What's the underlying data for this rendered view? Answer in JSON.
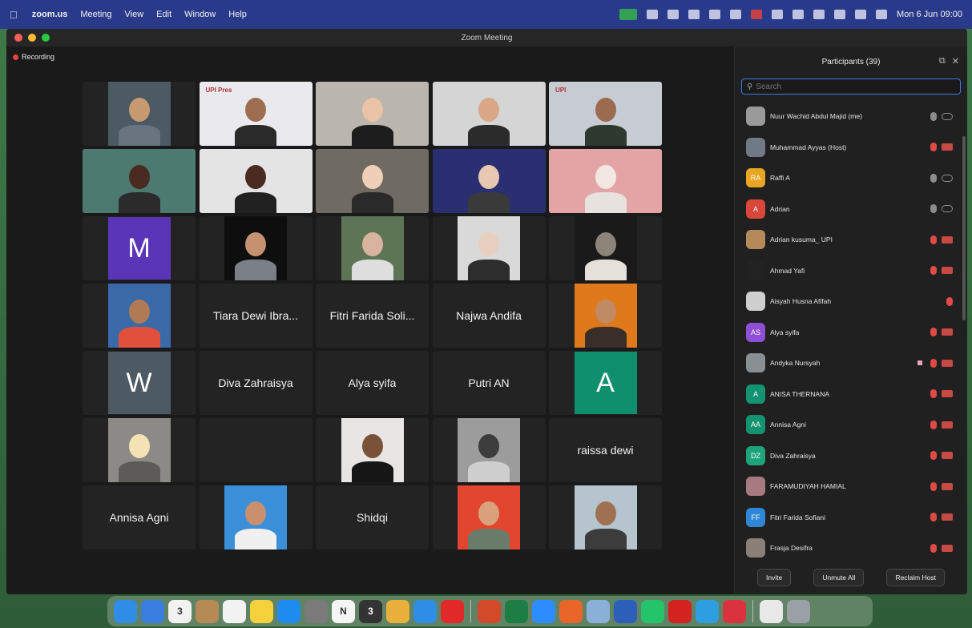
{
  "menubar": {
    "app_name": "zoom.us",
    "menus": [
      "Meeting",
      "View",
      "Edit",
      "Window",
      "Help"
    ],
    "clock": "Mon 6 Jun 09:00"
  },
  "window": {
    "title": "Zoom Meeting"
  },
  "recording": {
    "label": "Recording"
  },
  "gallery": {
    "tiles": [
      {
        "type": "video",
        "bg": "#4b5a63",
        "skin": "#c89a72",
        "shirt": "#6a7380"
      },
      {
        "type": "video",
        "bg": "#e9e9ee",
        "skin": "#9d6e50",
        "shirt": "#2a2a2a",
        "banner": "UPI Pres"
      },
      {
        "type": "video",
        "bg": "#bab6ad",
        "skin": "#e9c3a6",
        "shirt": "#1d1d1d"
      },
      {
        "type": "video",
        "bg": "#d5d5d5",
        "skin": "#d9a788",
        "shirt": "#2b2b2b"
      },
      {
        "type": "video",
        "bg": "#c7ccd3",
        "skin": "#9b6b4f",
        "shirt": "#2e3930",
        "banner": "UPI"
      },
      {
        "type": "video",
        "bg": "#4d7a70",
        "skin": "#4a2b1f",
        "shirt": "#2b2b2b",
        "speaking": true
      },
      {
        "type": "video",
        "bg": "#e4e4e4",
        "skin": "#4a2b20",
        "shirt": "#212121"
      },
      {
        "type": "video",
        "bg": "#6f6a62",
        "skin": "#f0cfb8",
        "shirt": "#2a2a2a"
      },
      {
        "type": "video",
        "bg": "#2a2f72",
        "skin": "#e8c8b0",
        "shirt": "#3a3a3a"
      },
      {
        "type": "video",
        "bg": "#e3a4a6",
        "skin": "#f2e8e1",
        "shirt": "#e8e2de"
      },
      {
        "type": "letter",
        "letter": "M",
        "color": "#5b35b8"
      },
      {
        "type": "video",
        "bg": "#0e0e0e",
        "skin": "#c49270",
        "shirt": "#7a7f88"
      },
      {
        "type": "video",
        "bg": "#5d7554",
        "skin": "#d8b4a0",
        "shirt": "#dedede"
      },
      {
        "type": "video",
        "bg": "#d9d9d9",
        "skin": "#e8d0c0",
        "shirt": "#2d2d2d"
      },
      {
        "type": "video",
        "bg": "#1a1a1a",
        "skin": "#8c8478",
        "shirt": "#e6e1da"
      },
      {
        "type": "video",
        "bg": "#3a6ba8",
        "skin": "#b07a55",
        "shirt": "#e0503a"
      },
      {
        "type": "name",
        "name": "Tiara Dewi Ibra..."
      },
      {
        "type": "name",
        "name": "Fitri Farida Soli..."
      },
      {
        "type": "name",
        "name": "Najwa Andifa"
      },
      {
        "type": "video",
        "bg": "#e0781c",
        "skin": "#c08a64",
        "shirt": "#3a2e28"
      },
      {
        "type": "letter",
        "letter": "W",
        "color": "#4e5a63"
      },
      {
        "type": "name",
        "name": "Diva Zahraisya"
      },
      {
        "type": "name",
        "name": "Alya syifa"
      },
      {
        "type": "name",
        "name": "Putri AN"
      },
      {
        "type": "letter",
        "letter": "A",
        "color": "#0f8f6e"
      },
      {
        "type": "video",
        "bg": "#8c8a86",
        "skin": "#f3e2b4",
        "shirt": "#5c5b58"
      },
      {
        "type": "empty"
      },
      {
        "type": "video",
        "bg": "#e8e6e4",
        "skin": "#7a5238",
        "shirt": "#161616"
      },
      {
        "type": "video",
        "bg": "#9c9c9c",
        "skin": "#3c3c3c",
        "shirt": "#cfcfcf"
      },
      {
        "type": "name",
        "name": "raissa dewi"
      },
      {
        "type": "name",
        "name": "Annisa Agni"
      },
      {
        "type": "video",
        "bg": "#3a8fd8",
        "skin": "#c8906c",
        "shirt": "#f0f0f0"
      },
      {
        "type": "name",
        "name": "Shidqi"
      },
      {
        "type": "video",
        "bg": "#e2462f",
        "skin": "#d9a27c",
        "shirt": "#6a7b6a"
      },
      {
        "type": "video",
        "bg": "#b6c4ce",
        "skin": "#a07052",
        "shirt": "#3c3c3c"
      }
    ]
  },
  "panel": {
    "title": "Participants (39)",
    "search_placeholder": "Search",
    "participants": [
      {
        "name": "Nuur Wachid Abdul Majid (me)",
        "initials": "",
        "color": "#9a9a9a",
        "mic": "on",
        "video": "on"
      },
      {
        "name": "Muhammad Ayyas (Host)",
        "initials": "",
        "color": "#6f7a86",
        "mic": "off",
        "video": "off"
      },
      {
        "name": "Raffi A",
        "initials": "RA",
        "color": "#e8a623",
        "mic": "on",
        "video": "on"
      },
      {
        "name": "Adrian",
        "initials": "A",
        "color": "#d9473b",
        "mic": "on",
        "video": "on"
      },
      {
        "name": "Adrian kusuma_ UPI",
        "initials": "",
        "color": "#b58a5a",
        "mic": "off",
        "video": "off"
      },
      {
        "name": "Ahmad Yafi",
        "initials": "",
        "color": "#222222",
        "mic": "off",
        "video": "off"
      },
      {
        "name": "Aisyah Husna Afifah",
        "initials": "",
        "color": "#cfcfcf",
        "mic": "off",
        "video": ""
      },
      {
        "name": "Alya syifa",
        "initials": "AS",
        "color": "#8e4fd6",
        "mic": "off",
        "video": "off"
      },
      {
        "name": "Andyka Nursyah",
        "initials": "",
        "color": "#8a8f94",
        "mic": "off",
        "video": "off",
        "hand": true
      },
      {
        "name": "ANISA THERNANA",
        "initials": "A",
        "color": "#13936f",
        "mic": "off",
        "video": "off"
      },
      {
        "name": "Annisa Agni",
        "initials": "AA",
        "color": "#13936f",
        "mic": "off",
        "video": "off"
      },
      {
        "name": "Diva Zahraisya",
        "initials": "DZ",
        "color": "#1fa37a",
        "mic": "off",
        "video": "off"
      },
      {
        "name": "FARAMUDIYAH HAMIAL",
        "initials": "",
        "color": "#a77a80",
        "mic": "off",
        "video": "off"
      },
      {
        "name": "Fitri Farida Sofiani",
        "initials": "FF",
        "color": "#2f86d6",
        "mic": "off",
        "video": "off"
      },
      {
        "name": "Frasja Desifra",
        "initials": "",
        "color": "#8a8078",
        "mic": "off",
        "video": "off"
      }
    ],
    "footer": {
      "invite": "Invite",
      "unmute_all": "Unmute All",
      "mute_all": "Reclaim Host"
    }
  },
  "dock": {
    "icons": [
      {
        "name": "finder-icon",
        "color": "#2f8de6"
      },
      {
        "name": "mail-icon",
        "color": "#3a7ee0"
      },
      {
        "name": "calendar-icon",
        "color": "#f2f2f2",
        "text": "3"
      },
      {
        "name": "notes-folder-icon",
        "color": "#b58a55"
      },
      {
        "name": "reminders-icon",
        "color": "#f2f2f2"
      },
      {
        "name": "notes-icon",
        "color": "#f5d13c"
      },
      {
        "name": "app-store-icon",
        "color": "#1f8cf0"
      },
      {
        "name": "photos-gallery-icon",
        "color": "#7a7a7a"
      },
      {
        "name": "notion-icon",
        "color": "#f5f5f5",
        "text": "N"
      },
      {
        "name": "calendar-alt-icon",
        "color": "#333333",
        "text": "3"
      },
      {
        "name": "chrome-icon",
        "color": "#e8b03a"
      },
      {
        "name": "safari-icon",
        "color": "#2f8de6"
      },
      {
        "name": "opera-icon",
        "color": "#e22a2a"
      },
      {
        "name": "powerpoint-icon",
        "color": "#d24a2a"
      },
      {
        "name": "excel-icon",
        "color": "#1e7d45"
      },
      {
        "name": "zoom-icon",
        "color": "#2d8cff"
      },
      {
        "name": "firefox-icon",
        "color": "#e8652a"
      },
      {
        "name": "preview-icon",
        "color": "#8ab0d8"
      },
      {
        "name": "word-icon",
        "color": "#2b5fb8"
      },
      {
        "name": "whatsapp-icon",
        "color": "#25c36a"
      },
      {
        "name": "acrobat-icon",
        "color": "#d4221f"
      },
      {
        "name": "telegram-icon",
        "color": "#2d9ee0"
      },
      {
        "name": "ms-icon",
        "color": "#d9343e"
      },
      {
        "name": "document-icon",
        "color": "#e8e8e8"
      },
      {
        "name": "trash-icon",
        "color": "#9aa0a6"
      }
    ]
  }
}
